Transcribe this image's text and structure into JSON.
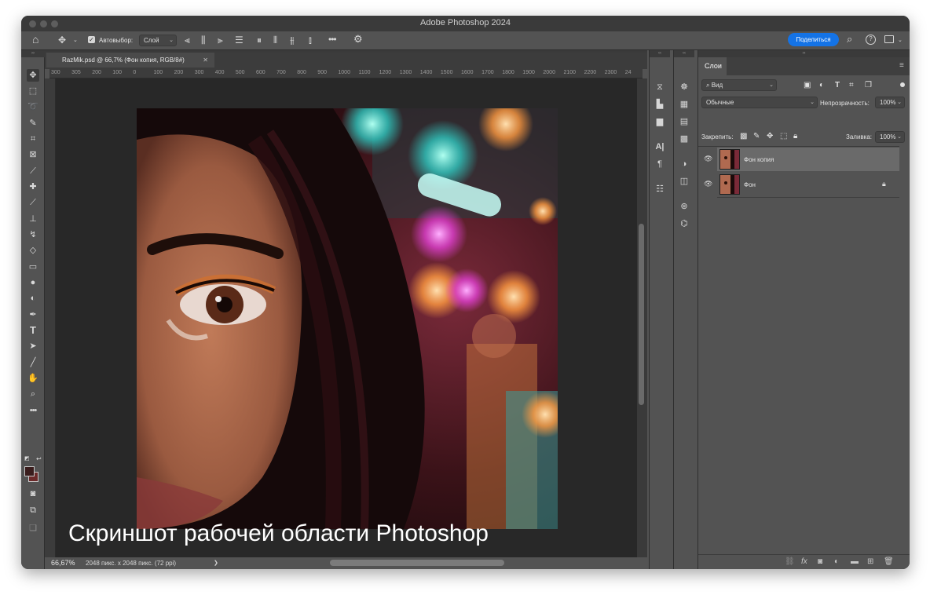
{
  "window": {
    "title": "Adobe Photoshop 2024"
  },
  "options_bar": {
    "auto_select_label": "Автовыбор:",
    "auto_select_value": "Слой",
    "more_label": "•••",
    "share_label": "Поделиться"
  },
  "document": {
    "tab_label": "RazMik.psd @ 66,7% (Фон копия, RGB/8#)"
  },
  "ruler": {
    "ticks": [
      "300",
      "305",
      "200",
      "100",
      "0",
      "100",
      "200",
      "300",
      "400",
      "500",
      "600",
      "700",
      "800",
      "900",
      "1000",
      "1100",
      "1200",
      "1300",
      "1400",
      "1500",
      "1600",
      "1700",
      "1800",
      "1900",
      "2000",
      "2100",
      "2200",
      "2300",
      "24"
    ]
  },
  "canvas": {
    "caption": "Скриншот рабочей области Photoshop"
  },
  "status": {
    "zoom": "66,67%",
    "doc_info": "2048 пикс. x 2048 пикс. (72 ppi)",
    "arrow": "❯"
  },
  "colors": {
    "accent": "#1473e6",
    "foreground": "#3a1d1d",
    "background": "#6b2a2a"
  },
  "layers_panel": {
    "tab_label": "Слои",
    "filter_label": "Вид",
    "blend_mode": "Обычные",
    "opacity_label": "Непрозрачность:",
    "opacity_value": "100%",
    "lock_label": "Закрепить:",
    "fill_label": "Заливка:",
    "fill_value": "100%",
    "layers": [
      {
        "name": "Фон копия",
        "selected": true,
        "locked": false
      },
      {
        "name": "Фон",
        "selected": false,
        "locked": true
      }
    ]
  }
}
